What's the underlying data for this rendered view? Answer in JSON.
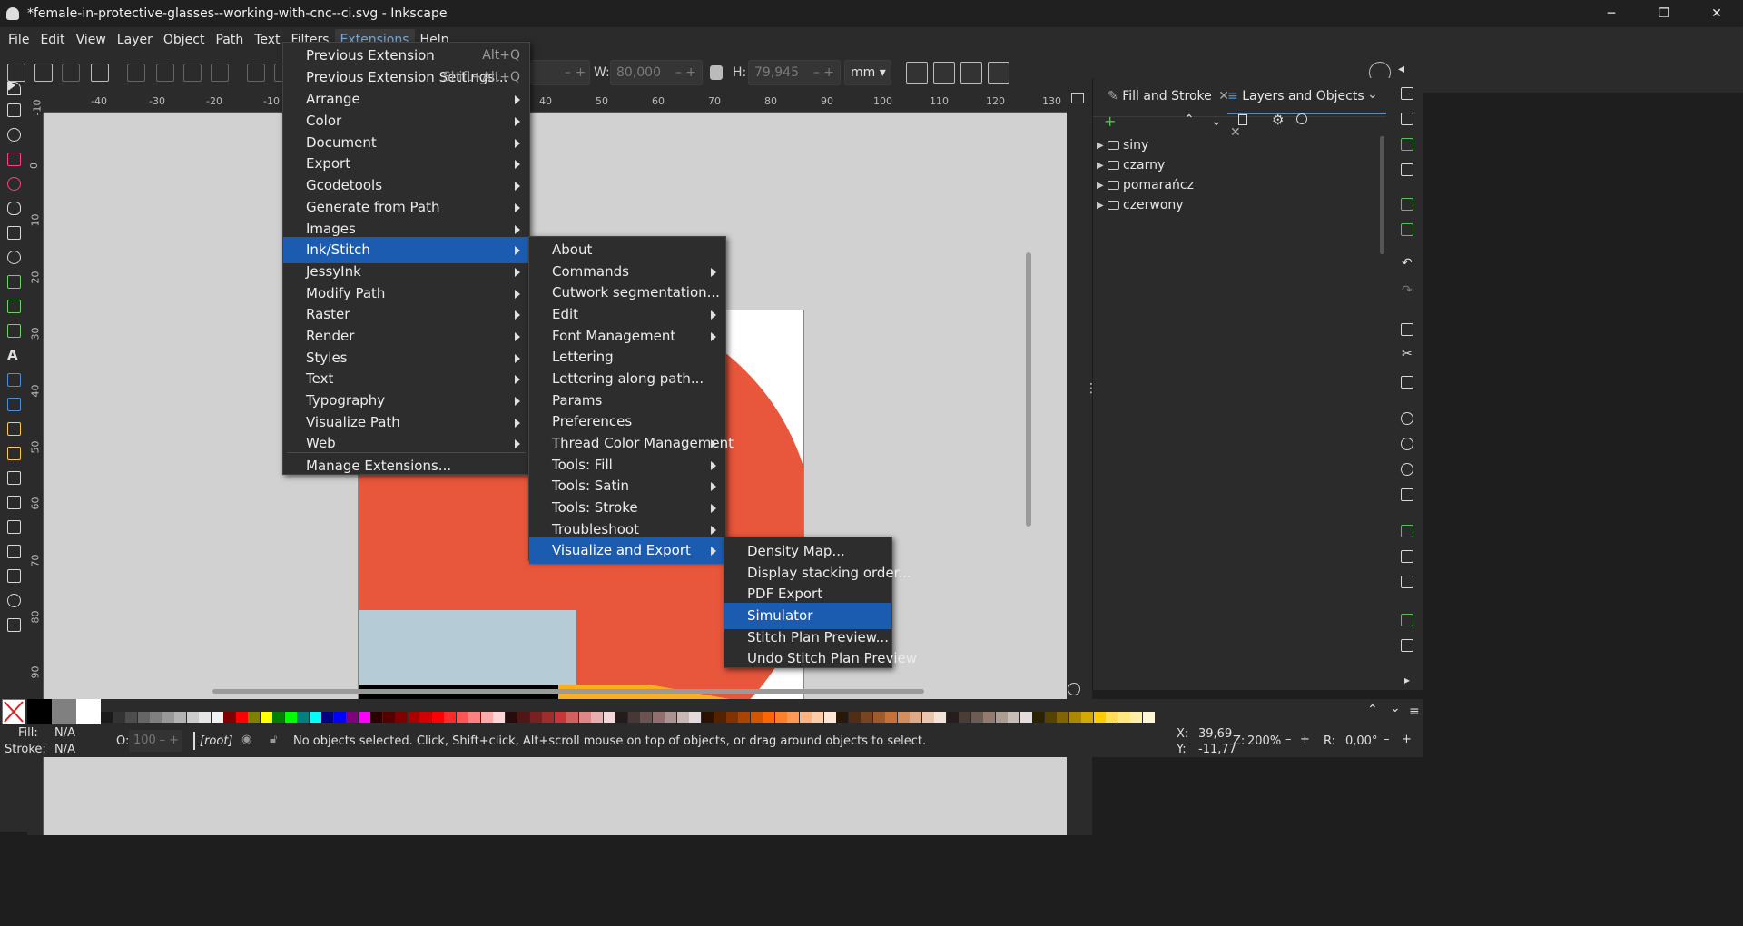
{
  "window": {
    "title": "*female-in-protective-glasses--working-with-cnc--ci.svg - Inkscape",
    "minimize": "─",
    "maximize": "❐",
    "close": "✕"
  },
  "menubar": [
    "File",
    "Edit",
    "View",
    "Layer",
    "Object",
    "Path",
    "Text",
    "Filters",
    "Extensions",
    "Help"
  ],
  "toolbar": {
    "w_label": "W:",
    "w_value": "80,000",
    "h_label": "H:",
    "h_value": "79,945",
    "unit": "mm"
  },
  "extensions_menu": {
    "items": [
      {
        "label": "Previous Extension",
        "shortcut": "Alt+Q"
      },
      {
        "label": "Previous Extension Settings...",
        "shortcut": "Shift+Alt+Q"
      },
      {
        "label": "Arrange"
      },
      {
        "label": "Color"
      },
      {
        "label": "Document"
      },
      {
        "label": "Export"
      },
      {
        "label": "Gcodetools"
      },
      {
        "label": "Generate from Path"
      },
      {
        "label": "Images"
      },
      {
        "label": "Ink/Stitch"
      },
      {
        "label": "JessyInk"
      },
      {
        "label": "Modify Path"
      },
      {
        "label": "Raster"
      },
      {
        "label": "Render"
      },
      {
        "label": "Styles"
      },
      {
        "label": "Text"
      },
      {
        "label": "Typography"
      },
      {
        "label": "Visualize Path"
      },
      {
        "label": "Web"
      },
      {
        "label": "Manage Extensions..."
      }
    ]
  },
  "inkstitch_menu": {
    "items": [
      "About",
      "Commands",
      "Cutwork segmentation...",
      "Edit",
      "Font Management",
      "Lettering",
      "Lettering along path...",
      "Params",
      "Preferences",
      "Thread Color Management",
      "Tools: Fill",
      "Tools: Satin",
      "Tools: Stroke",
      "Troubleshoot",
      "Visualize and Export"
    ]
  },
  "visualize_menu": {
    "items": [
      "Density Map...",
      "Display stacking order...",
      "PDF Export",
      "Simulator",
      "Stitch Plan Preview...",
      "Undo Stitch Plan Preview"
    ]
  },
  "rulers": {
    "h_ticks": [
      "-40",
      "-30",
      "-20",
      "-10",
      "40",
      "50",
      "60",
      "70",
      "80",
      "90",
      "100",
      "110",
      "120",
      "130"
    ],
    "v_ticks": [
      "-10",
      "0",
      "10",
      "20",
      "30",
      "40",
      "50",
      "60",
      "70",
      "80",
      "90"
    ]
  },
  "panel": {
    "tabs": [
      "Fill and Stroke",
      "Layers and Objects"
    ],
    "layers": [
      "siny",
      "czarny",
      "pomarańcz",
      "czerwony"
    ]
  },
  "palette": {
    "colors": [
      "#000000",
      "#808080",
      "#ffffff",
      "#1a1a1a",
      "#333333",
      "#4d4d4d",
      "#666666",
      "#808080",
      "#999999",
      "#b3b3b3",
      "#cccccc",
      "#e6e6e6",
      "#f2f2f2",
      "#800000",
      "#ff0000",
      "#808000",
      "#ffff00",
      "#008000",
      "#00ff00",
      "#008080",
      "#00ffff",
      "#000080",
      "#0000ff",
      "#800080",
      "#ff00ff",
      "#2b0000",
      "#550000",
      "#800000",
      "#aa0000",
      "#d40000",
      "#ff0000",
      "#ff2a2a",
      "#ff5555",
      "#ff8080",
      "#ffaaaa",
      "#ffd5d5",
      "#280b0b",
      "#501616",
      "#782121",
      "#a02c2c",
      "#c83737",
      "#d35f5f",
      "#de8787",
      "#e9afaf",
      "#f4d7d7",
      "#241c1c",
      "#483737",
      "#6c5353",
      "#916f6f",
      "#ac9393",
      "#c8b7b7",
      "#e3dbdb",
      "#2b1100",
      "#552200",
      "#803300",
      "#aa4400",
      "#d45500",
      "#ff6600",
      "#ff7f2a",
      "#ff9955",
      "#ffb380",
      "#ffccaa",
      "#ffe6d5",
      "#28170b",
      "#502d16",
      "#784421",
      "#a05a2c",
      "#c87137",
      "#d38d5f",
      "#deaa87",
      "#e9c6af",
      "#f4e3d7",
      "#241f1c",
      "#483e37",
      "#6c5d53",
      "#917c6f",
      "#ac9d93",
      "#c8beb7",
      "#e3dedb",
      "#2b2200",
      "#554400",
      "#806600",
      "#aa8800",
      "#d4aa00",
      "#ffcc00",
      "#ffdd55",
      "#ffe680",
      "#ffeeaa",
      "#fff6d5"
    ]
  },
  "status": {
    "fill_label": "Fill:",
    "fill_value": "N/A",
    "stroke_label": "Stroke:",
    "stroke_value": "N/A",
    "opacity_label": "O:",
    "opacity_value": "100",
    "layer": "[root]",
    "message": "No objects selected. Click, Shift+click, Alt+scroll mouse on top of objects, or drag around objects to select.",
    "x_label": "X:",
    "x_value": "39,69",
    "y_label": "Y:",
    "y_value": "-11,77",
    "zoom_label": "Z:",
    "zoom_value": "200%",
    "rotate_label": "R:",
    "rotate_value": "0,00°"
  },
  "artwork_colors": {
    "red": "#e8563c",
    "black": "#000000",
    "lightblue": "#b5ccd7",
    "orange": "#f8ae1f"
  }
}
